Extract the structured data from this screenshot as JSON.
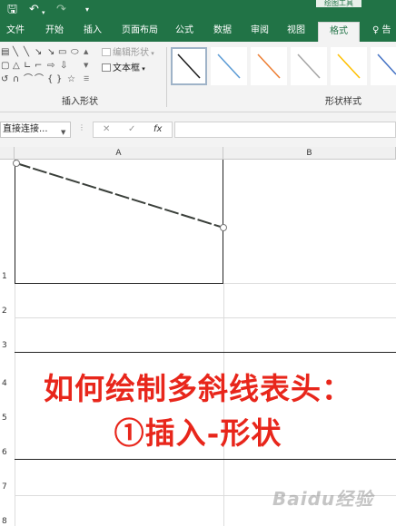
{
  "titlebar": {
    "contextual_tab_label": "绘图工具",
    "qat_icons": [
      "save-icon",
      "undo-icon",
      "undo-dropdown-icon",
      "redo-icon",
      "customize-qat-icon"
    ]
  },
  "tabs": [
    {
      "label": "文件"
    },
    {
      "label": "开始"
    },
    {
      "label": "插入"
    },
    {
      "label": "页面布局"
    },
    {
      "label": "公式"
    },
    {
      "label": "数据"
    },
    {
      "label": "审阅"
    },
    {
      "label": "视图"
    },
    {
      "label": "格式",
      "active": true
    },
    {
      "label": "♀ 告"
    }
  ],
  "ribbon": {
    "insert_shapes": {
      "group_label": "插入形状",
      "edit_shape_label": "编辑形状",
      "textbox_label": "文本框"
    },
    "shape_styles": {
      "group_label": "形状样式",
      "swatch_colors": [
        "#1a1a1a",
        "#5b9bd5",
        "#ed7d31",
        "#a5a5a5",
        "#ffc000",
        "#4472c4"
      ]
    }
  },
  "formula_bar": {
    "name_box": "直接连接...",
    "cancel": "✕",
    "enter": "✓",
    "fx": "fx",
    "value": ""
  },
  "sheet": {
    "columns": [
      "A",
      "B"
    ],
    "rows": [
      "1",
      "2",
      "3",
      "4",
      "5",
      "6",
      "7",
      "8"
    ]
  },
  "overlay": {
    "line1": "如何绘制多斜线表头：",
    "line2": "①插入-形状",
    "color": "#e8261b"
  },
  "watermark": "Baidu经验"
}
